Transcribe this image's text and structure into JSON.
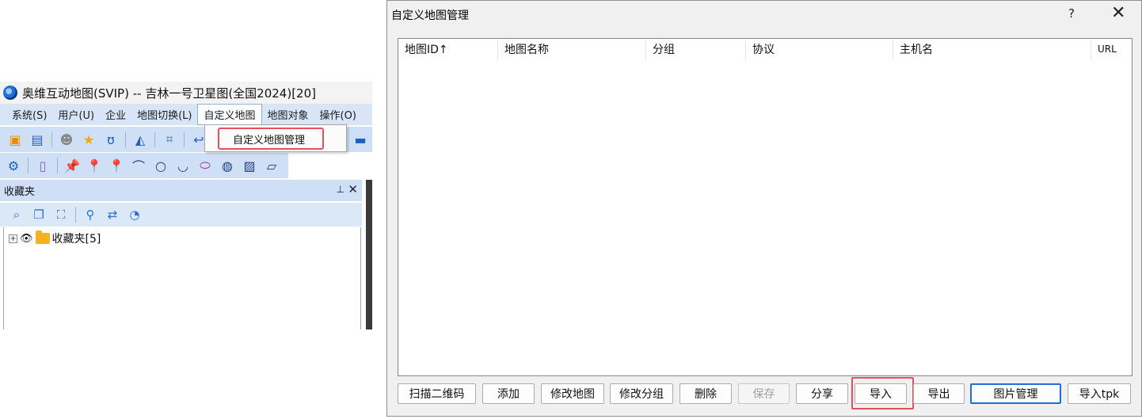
{
  "app": {
    "title": "奥维互动地图(SVIP) -- 吉林一号卫星图(全国2024)[20]",
    "menu": [
      "系统(S)",
      "用户(U)",
      "企业",
      "地图切换(L)",
      "自定义地图",
      "地图对象",
      "操作(O)"
    ],
    "active_menu_index": 4,
    "dropdown_item": "自定义地图管理",
    "panel_title": "收藏夹",
    "tree_item": "收藏夹[5]"
  },
  "dialog": {
    "title": "自定义地图管理",
    "help": "?",
    "close": "✕",
    "columns": [
      "地图ID↑",
      "地图名称",
      "分组",
      "协议",
      "主机名",
      "URL"
    ],
    "buttons": {
      "scan_qr": "扫描二维码",
      "add": "添加",
      "edit_map": "修改地图",
      "edit_group": "修改分组",
      "delete": "删除",
      "save": "保存",
      "share": "分享",
      "import": "导入",
      "export": "导出",
      "image_manage": "图片管理",
      "import_tpk": "导入tpk"
    }
  },
  "colors": {
    "highlight": "#e0525f",
    "menubar": "#d7e5f7",
    "toolbar": "#cfe0f6",
    "accent": "#1f6fd6"
  }
}
